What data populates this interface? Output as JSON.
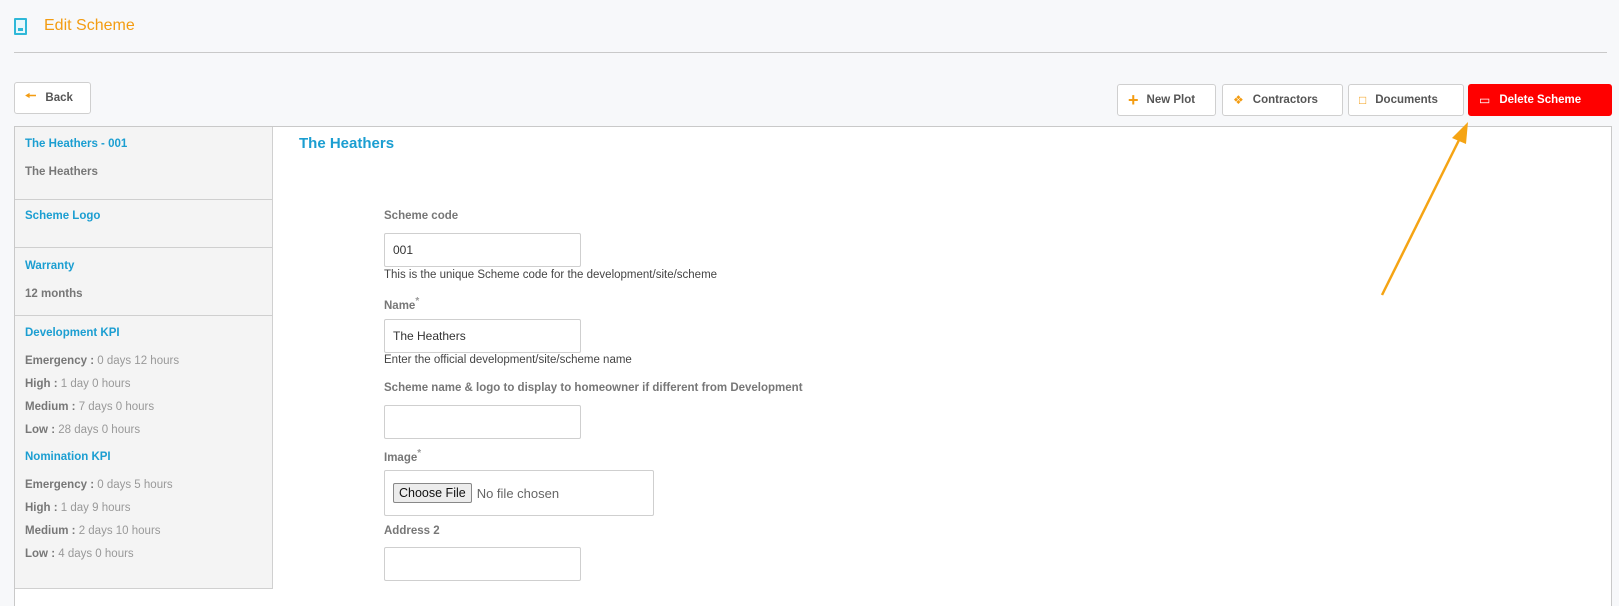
{
  "header": {
    "title": "Edit Scheme"
  },
  "toolbar": {
    "back": "Back",
    "new_plot": "New Plot",
    "contractors": "Contractors",
    "documents": "Documents",
    "delete_scheme": "Delete Scheme"
  },
  "sidebar": {
    "scheme_link": "The Heathers - 001",
    "scheme_name": "The Heathers",
    "logo_link": "Scheme Logo",
    "warranty_link": "Warranty",
    "warranty_value": "12 months",
    "dev_kpi_title": "Development KPI",
    "dev_kpi": [
      {
        "level": "Emergency :",
        "value": "0 days 12 hours"
      },
      {
        "level": "High :",
        "value": "1 day 0 hours"
      },
      {
        "level": "Medium :",
        "value": "7 days 0 hours"
      },
      {
        "level": "Low :",
        "value": "28 days 0 hours"
      }
    ],
    "nom_kpi_title": "Nomination KPI",
    "nom_kpi": [
      {
        "level": "Emergency :",
        "value": "0 days 5 hours"
      },
      {
        "level": "High :",
        "value": "1 day 9 hours"
      },
      {
        "level": "Medium :",
        "value": "2 days 10 hours"
      },
      {
        "level": "Low :",
        "value": "4 days 0 hours"
      }
    ]
  },
  "form": {
    "title": "The Heathers",
    "scheme_code_label": "Scheme code",
    "scheme_code_value": "001",
    "scheme_code_help": "This is the unique Scheme code for the development/site/scheme",
    "name_label": "Name",
    "name_value": "The Heathers",
    "name_help": "Enter the official development/site/scheme name",
    "display_name_label": "Scheme name & logo to display to homeowner if different from Development",
    "display_name_value": "",
    "image_label": "Image",
    "choose_file": "Choose File",
    "no_file": "No file chosen",
    "address2_label": "Address 2",
    "address2_value": "",
    "required_mark": "*"
  },
  "colors": {
    "accent_orange": "#f39c12",
    "link_blue": "#1b9ed1",
    "danger_red": "#ff0000"
  }
}
